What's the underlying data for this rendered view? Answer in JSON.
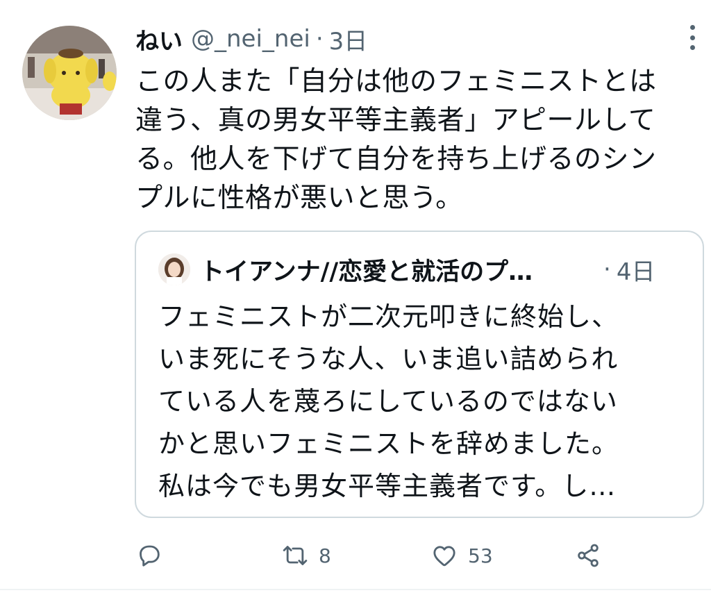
{
  "tweet": {
    "display_name": "ねい",
    "handle": "@_nei_nei",
    "separator": "·",
    "time": "3日",
    "text_lines": [
      "この人また「自分は他のフェミニストとは",
      "違う、真の男女平等主義者」アピールして",
      "る。他人を下げて自分を持ち上げるのシン",
      "プルに性格が悪いと思う。"
    ],
    "avatar_icon": "pompompurin-avatar-icon"
  },
  "quote": {
    "display_name": "トイアンナ//恋愛と就活のプ…",
    "separator": "·",
    "time": "4日",
    "text_lines": [
      "フェミニストが二次元叩きに終始し、",
      "いま死にそうな人、いま追い詰められ",
      "ている人を蔑ろにしているのではない",
      "かと思いフェミニストを辞めました。",
      "私は今でも男女平等主義者です。し…"
    ],
    "avatar_icon": "user-photo-avatar-icon"
  },
  "actions": {
    "reply_count": "",
    "retweet_count": "8",
    "like_count": "53"
  },
  "colors": {
    "text": "#0f1419",
    "secondary": "#536471",
    "border": "#cfd9de"
  }
}
